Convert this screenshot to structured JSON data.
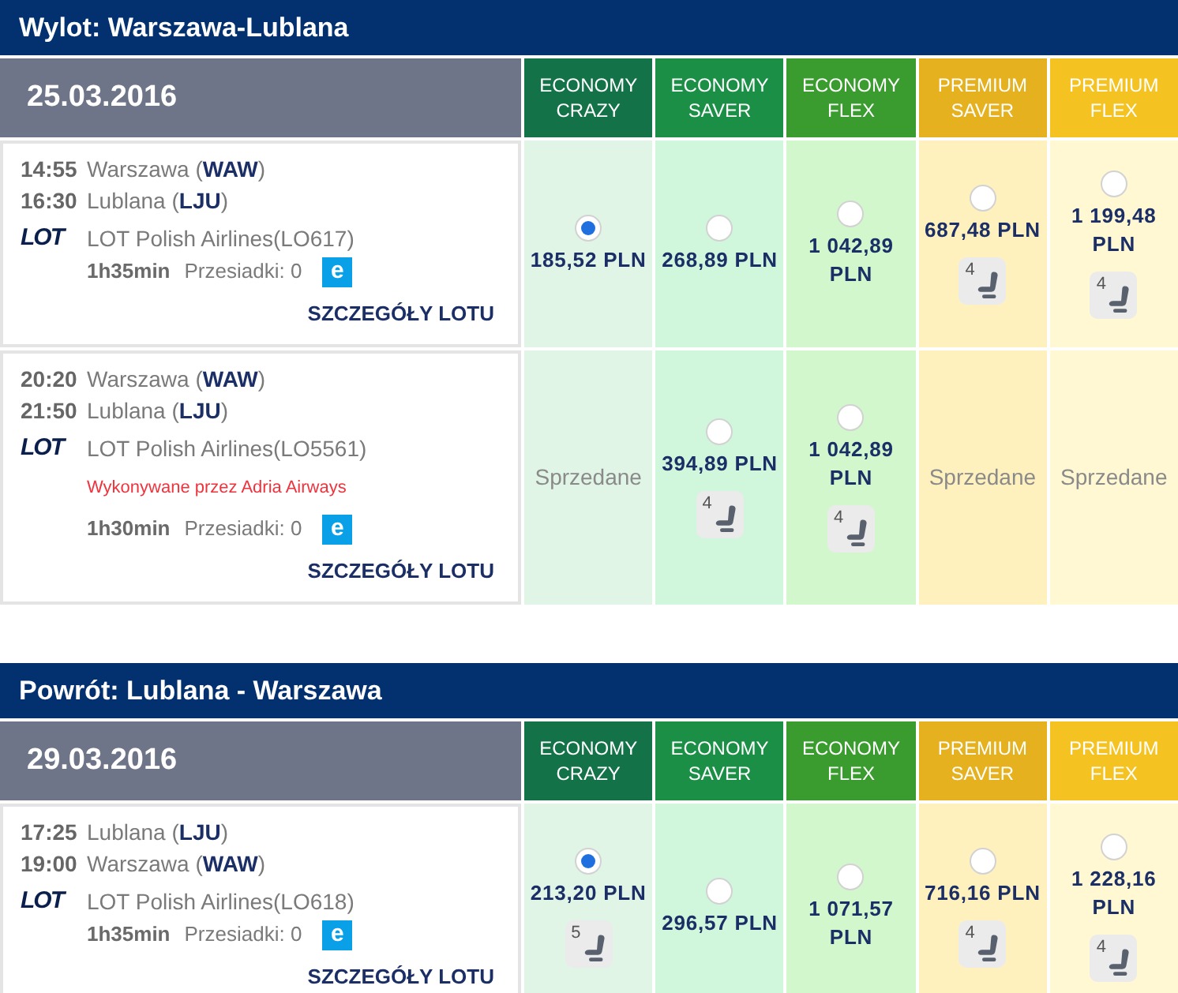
{
  "sections": [
    {
      "title": "Wylot: Warszawa-Lublana",
      "date": "25.03.2016",
      "fare_columns": [
        {
          "label": "ECONOMY CRAZY",
          "color": "#137247"
        },
        {
          "label": "ECONOMY SAVER",
          "color": "#1a8f45"
        },
        {
          "label": "ECONOMY FLEX",
          "color": "#3a9c2e"
        },
        {
          "label": "PREMIUM SAVER",
          "color": "#e6b11e"
        },
        {
          "label": "PREMIUM FLEX",
          "color": "#f5c321"
        }
      ],
      "flights": [
        {
          "departure": {
            "time": "14:55",
            "place": "Warszawa (**WAW**)"
          },
          "arrival": {
            "time": "16:30",
            "place": "Lublana (**LJU**)"
          },
          "airline_logo": "LOT",
          "airline": "LOT Polish Airlines(LO617)",
          "duration": "1h35min",
          "stops": "Przesiadki: 0",
          "badge": "e",
          "details_link": "SZCZEGÓŁY LOTU",
          "fares": [
            {
              "kind": "price",
              "price": "185,52 PLN",
              "selected": true
            },
            {
              "kind": "price",
              "price": "268,89 PLN",
              "selected": false
            },
            {
              "kind": "price",
              "price": "1 042,89 PLN",
              "selected": false
            },
            {
              "kind": "price",
              "price": "687,48 PLN",
              "selected": false,
              "seats_left": "4"
            },
            {
              "kind": "price",
              "price": "1 199,48 PLN",
              "selected": false,
              "seats_left": "4"
            }
          ]
        },
        {
          "departure": {
            "time": "20:20",
            "place": "Warszawa (**WAW**)"
          },
          "arrival": {
            "time": "21:50",
            "place": "Lublana (**LJU**)"
          },
          "airline_logo": "LOT",
          "airline": "LOT Polish Airlines(LO5561)",
          "operated_by": "Wykonywane przez Adria Airways",
          "duration": "1h30min",
          "stops": "Przesiadki: 0",
          "badge": "e",
          "details_link": "SZCZEGÓŁY LOTU",
          "fares": [
            {
              "kind": "sold_out",
              "label": "Sprzedane"
            },
            {
              "kind": "price",
              "price": "394,89 PLN",
              "selected": false,
              "seats_left": "4"
            },
            {
              "kind": "price",
              "price": "1 042,89 PLN",
              "selected": false,
              "seats_left": "4"
            },
            {
              "kind": "sold_out",
              "label": "Sprzedane"
            },
            {
              "kind": "sold_out",
              "label": "Sprzedane"
            }
          ]
        }
      ]
    },
    {
      "title": "Powrót: Lublana - Warszawa",
      "date": "29.03.2016",
      "fare_columns": [
        {
          "label": "ECONOMY CRAZY",
          "color": "#137247"
        },
        {
          "label": "ECONOMY SAVER",
          "color": "#1a8f45"
        },
        {
          "label": "ECONOMY FLEX",
          "color": "#3a9c2e"
        },
        {
          "label": "PREMIUM SAVER",
          "color": "#e6b11e"
        },
        {
          "label": "PREMIUM FLEX",
          "color": "#f5c321"
        }
      ],
      "flights": [
        {
          "departure": {
            "time": "17:25",
            "place": "Lublana (**LJU**)"
          },
          "arrival": {
            "time": "19:00",
            "place": "Warszawa (**WAW**)"
          },
          "airline_logo": "LOT",
          "airline": "LOT Polish Airlines(LO618)",
          "duration": "1h35min",
          "stops": "Przesiadki: 0",
          "badge": "e",
          "details_link": "SZCZEGÓŁY LOTU",
          "fares": [
            {
              "kind": "price",
              "price": "213,20 PLN",
              "selected": true,
              "seats_left": "5"
            },
            {
              "kind": "price",
              "price": "296,57 PLN",
              "selected": false
            },
            {
              "kind": "price",
              "price": "1 071,57 PLN",
              "selected": false
            },
            {
              "kind": "price",
              "price": "716,16 PLN",
              "selected": false,
              "seats_left": "4"
            },
            {
              "kind": "price",
              "price": "1 228,16 PLN",
              "selected": false,
              "seats_left": "4"
            }
          ]
        }
      ]
    }
  ]
}
